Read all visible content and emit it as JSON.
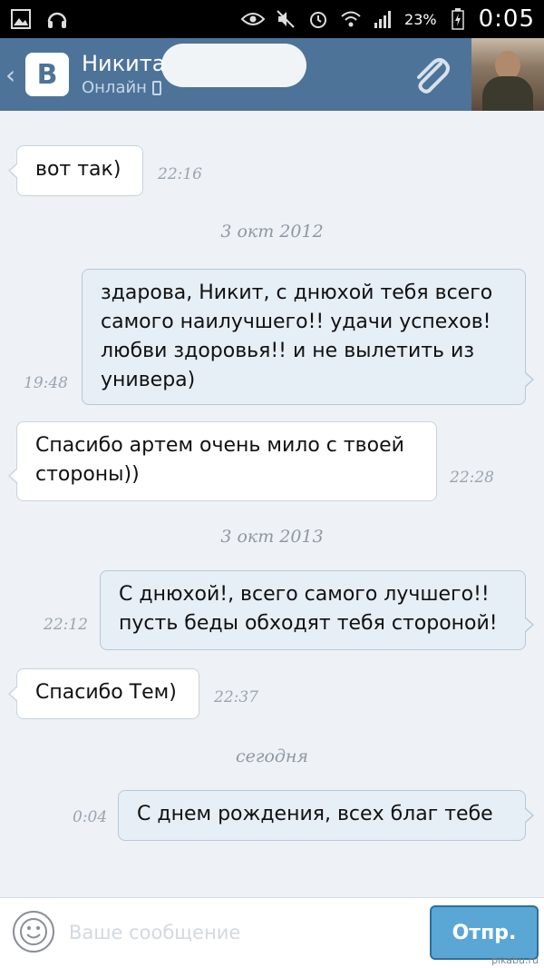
{
  "status_bar": {
    "battery_percent": "23%",
    "clock": "0:05"
  },
  "header": {
    "contact_name": "Никита",
    "status": "Онлайн",
    "logo_text": "B"
  },
  "messages": [
    {
      "direction": "in",
      "text": "вот так)",
      "time": "22:16"
    },
    {
      "type": "date",
      "text": "3 окт 2012"
    },
    {
      "direction": "out",
      "text": "здарова, Никит, с днюхой тебя всего самого наилучшего!! удачи успехов! любви здоровья!! и не вылетить из универа)",
      "time": "19:48"
    },
    {
      "direction": "in",
      "text": "Спасибо артем очень мило с твоей стороны))",
      "time": "22:28"
    },
    {
      "type": "date",
      "text": "3 окт 2013"
    },
    {
      "direction": "out",
      "text": "С днюхой!, всего самого лучшего!! пусть беды обходят тебя стороной!",
      "time": "22:12"
    },
    {
      "direction": "in",
      "text": "Спасибо Тем)",
      "time": "22:37"
    },
    {
      "type": "date",
      "text": "сегодня"
    },
    {
      "direction": "out",
      "text": "С днем рождения, всех благ тебе",
      "time": "0:04"
    }
  ],
  "input": {
    "placeholder": "Ваше сообщение",
    "send_label": "Отпр."
  },
  "watermark": "pikabu.ru",
  "colors": {
    "header_bg": "#4d7399",
    "outgoing_bubble": "#e6eef6",
    "incoming_bubble": "#ffffff",
    "send_button": "#5aa7d6"
  },
  "icons": {
    "status_bar": [
      "gallery-icon",
      "headset-icon",
      "eye-icon",
      "mute-icon",
      "alarm-icon",
      "wifi-icon",
      "signal-icon",
      "battery-icon"
    ],
    "header": [
      "back-chevron-icon",
      "vk-logo-icon",
      "phone-icon",
      "paperclip-icon"
    ],
    "input": [
      "smiley-icon"
    ]
  }
}
